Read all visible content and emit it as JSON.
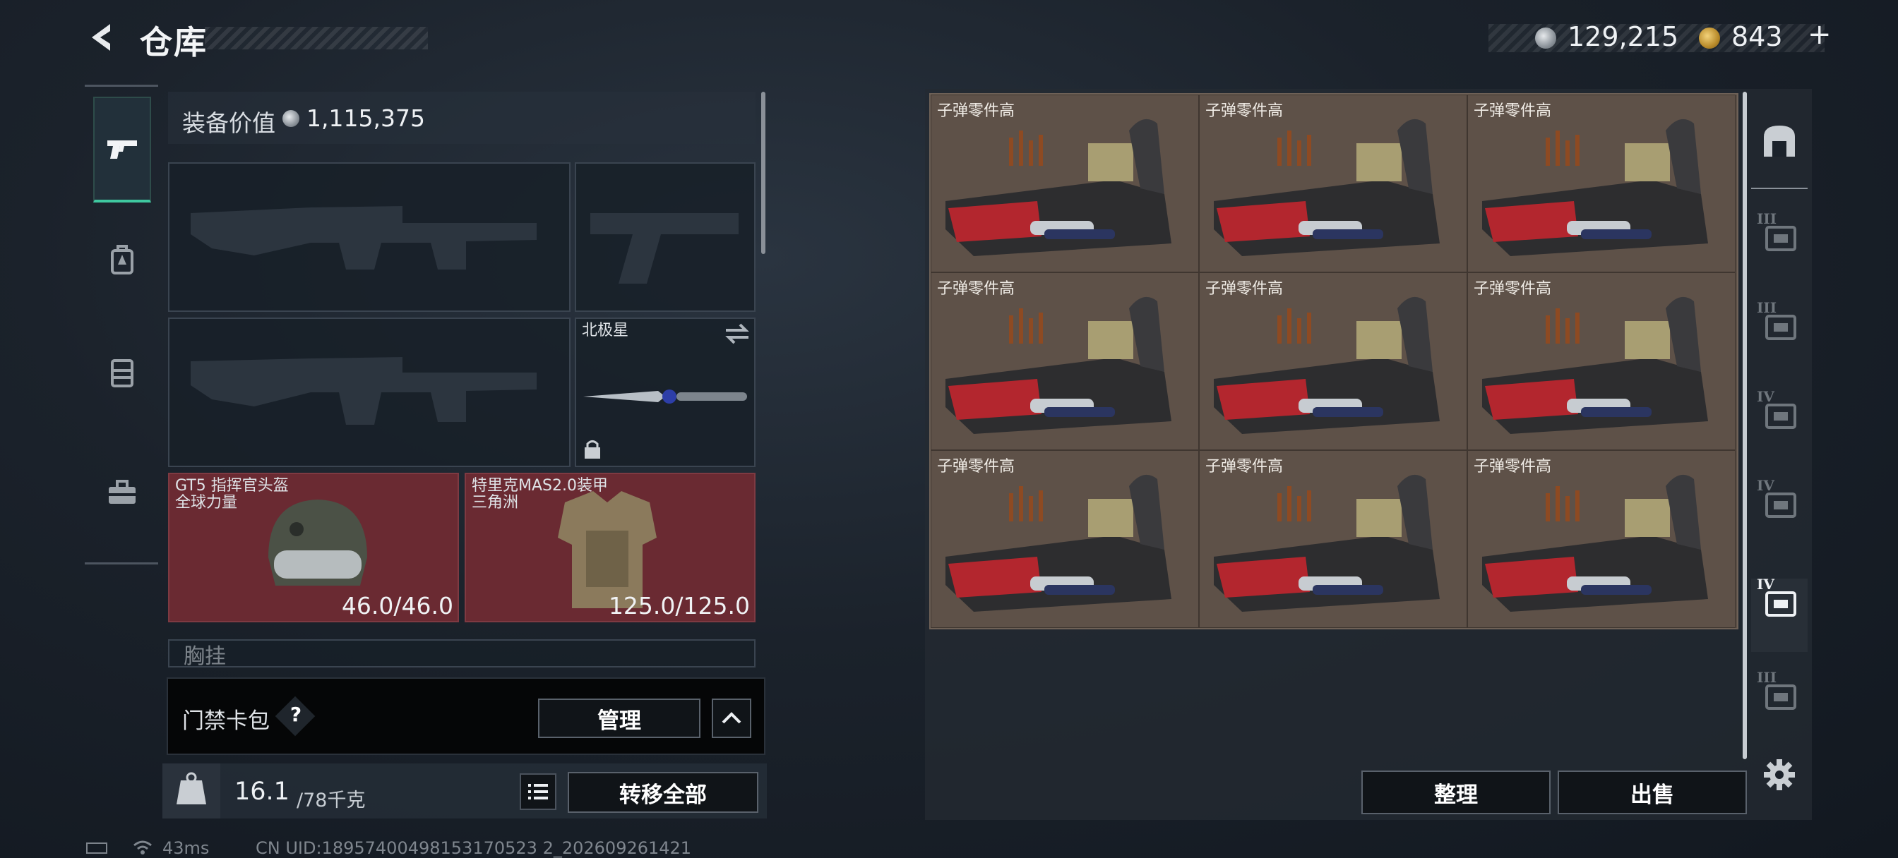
{
  "header": {
    "title": "仓库",
    "currency_silver": "129,215",
    "currency_gold": "843",
    "currency_gold_add": "+"
  },
  "left_rail": {
    "tabs": [
      "weapons-icon",
      "backpack-icon",
      "chest-rig-icon",
      "toolbox-icon"
    ],
    "active": "weapons-icon"
  },
  "loadout": {
    "equip_value_label": "装备价值",
    "equip_value": "1,115,375",
    "melee_name": "北极星",
    "helmet_name": "GT5 指挥官头盔",
    "helmet_sub": "全球力量",
    "helmet_durability": "46.0/46.0",
    "armor_name": "特里克MAS2.0装甲",
    "armor_sub": "三角洲",
    "armor_durability": "125.0/125.0",
    "chest_label": "胸挂"
  },
  "keycard": {
    "label": "门禁卡包",
    "help": "?",
    "manage_label": "管理"
  },
  "weight": {
    "current": "16.1",
    "max": "/78千克",
    "transfer_label": "转移全部"
  },
  "status": {
    "ping": "43ms",
    "uid": "CN UID:18957400498153170523 2_202609261421"
  },
  "storage": {
    "items": [
      {
        "label": "子弹零件高"
      },
      {
        "label": "子弹零件高"
      },
      {
        "label": "子弹零件高"
      },
      {
        "label": "子弹零件高"
      },
      {
        "label": "子弹零件高"
      },
      {
        "label": "子弹零件高"
      },
      {
        "label": "子弹零件高"
      },
      {
        "label": "子弹零件高"
      },
      {
        "label": "子弹零件高"
      }
    ],
    "sort_label": "整理",
    "sell_label": "出售"
  },
  "right_rail": {
    "items": [
      {
        "tier": "",
        "icon": "safe-box-icon"
      },
      {
        "tier": "III",
        "icon": "tier3-case-icon"
      },
      {
        "tier": "III",
        "icon": "tier3-tool-case-icon"
      },
      {
        "tier": "IV",
        "icon": "tier4-folder-case-icon"
      },
      {
        "tier": "IV",
        "icon": "tier4-medical-case-icon"
      },
      {
        "tier": "IV",
        "icon": "tier4-gadget-case-icon"
      },
      {
        "tier": "III",
        "icon": "tier3-box-icon"
      }
    ],
    "settings_icon": "gear-icon"
  },
  "colors": {
    "accent_green": "#3fc8a0",
    "item_bg_red": "#6a2a32",
    "item_bg_brown": "#5e5148"
  }
}
